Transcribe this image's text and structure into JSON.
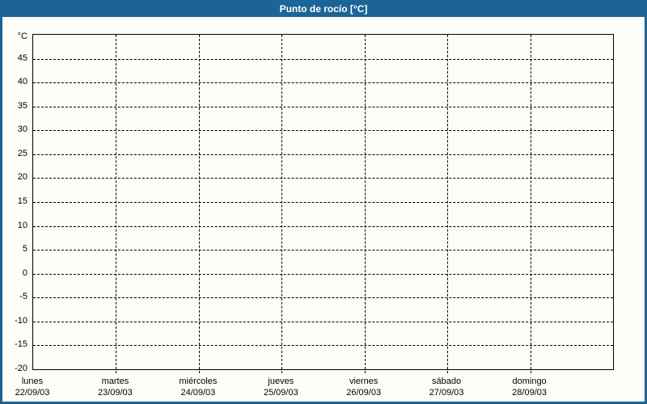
{
  "window": {
    "title": "Punto de rocío [°C]"
  },
  "colors": {
    "header_bg": "#1d6496",
    "header_text": "#ffffff",
    "frame": "#1d6496",
    "panel_bg": "#fefef9",
    "grid": "#000000",
    "text": "#000000"
  },
  "chart_data": {
    "type": "line",
    "title": "Punto de rocío [°C]",
    "ylabel": "°C",
    "xlabel": "",
    "ylim": [
      -20,
      50
    ],
    "ytick_step": 5,
    "yticks": [
      45,
      40,
      35,
      30,
      25,
      20,
      15,
      10,
      5,
      0,
      -5,
      -10,
      -15,
      -20
    ],
    "x_categories": [
      {
        "day": "lunes",
        "date": "22/09/03"
      },
      {
        "day": "martes",
        "date": "23/09/03"
      },
      {
        "day": "miércoles",
        "date": "24/09/03"
      },
      {
        "day": "jueves",
        "date": "25/09/03"
      },
      {
        "day": "viernes",
        "date": "26/09/03"
      },
      {
        "day": "sábado",
        "date": "27/09/03"
      },
      {
        "day": "domingo",
        "date": "28/09/03"
      }
    ],
    "series": [],
    "grid": true,
    "legend": false
  }
}
